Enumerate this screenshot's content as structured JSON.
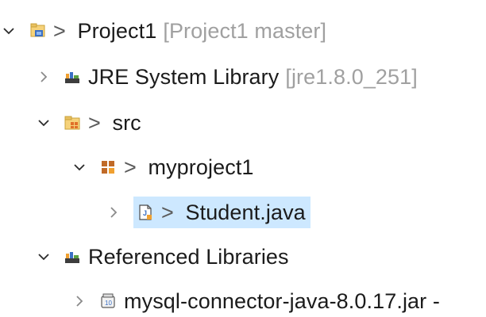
{
  "tree": {
    "project": {
      "prefix": "> ",
      "name": "Project1",
      "decoration": "[Project1 master]",
      "expanded": true,
      "icon": "project-icon"
    },
    "jre": {
      "name": "JRE System Library",
      "decoration": "[jre1.8.0_251]",
      "expanded": false,
      "icon": "library-icon"
    },
    "src": {
      "prefix": "> ",
      "name": "src",
      "expanded": true,
      "icon": "source-folder-icon"
    },
    "package": {
      "prefix": "> ",
      "name": "myproject1",
      "expanded": true,
      "icon": "package-icon"
    },
    "student": {
      "prefix": "> ",
      "name": "Student.java",
      "expanded": false,
      "selected": true,
      "icon": "java-file-icon"
    },
    "referenced": {
      "name": "Referenced Libraries",
      "expanded": true,
      "icon": "library-icon"
    },
    "mysql": {
      "name": "mysql-connector-java-8.0.17.jar -",
      "expanded": false,
      "icon": "jar-icon"
    }
  },
  "colors": {
    "selection": "#cde8ff",
    "decoration_text": "#a0a0a0",
    "text": "#1b1b1b",
    "accent_orange": "#f0a030",
    "accent_blue": "#3a6fc4"
  }
}
